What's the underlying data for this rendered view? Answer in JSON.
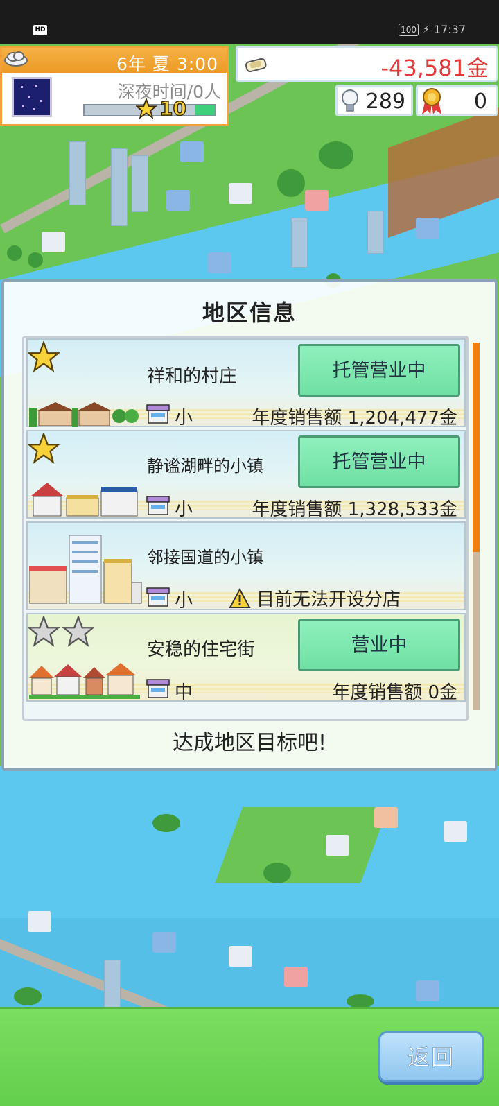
{
  "status_bar": {
    "hd": "HD",
    "battery": "100",
    "time": "17:37"
  },
  "hud": {
    "date": "6年 夏 3:00",
    "time_label": "深夜时间/0人",
    "level": "10",
    "level_progress": 0.15,
    "money": "-43,581金",
    "ideas": "289",
    "medals": "0"
  },
  "dialog": {
    "title": "地区信息",
    "footer": "达成地区目标吧!",
    "regions": [
      {
        "name": "祥和的村庄",
        "stars": 1,
        "status": "托管营业中",
        "size": "小",
        "sales": "年度销售额 1,204,477金"
      },
      {
        "name": "静谧湖畔的小镇",
        "stars": 1,
        "status": "托管营业中",
        "size": "小",
        "sales": "年度销售额 1,328,533金"
      },
      {
        "name": "邻接国道的小镇",
        "stars": 0,
        "status": "",
        "size": "小",
        "warning": "目前无法开设分店"
      },
      {
        "name": "安稳的住宅街",
        "stars": 0,
        "status": "营业中",
        "size": "中",
        "sales": "年度销售额 0金"
      }
    ],
    "scroll_fraction": 0.57
  },
  "bottom": {
    "back_label": "返回"
  },
  "colors": {
    "hud_orange": "#f3a23a",
    "money_red": "#e5383b",
    "status_button_green": "#8ff0bd",
    "back_button_blue": "#8fc6ee",
    "scroll_orange": "#ef7e10"
  }
}
